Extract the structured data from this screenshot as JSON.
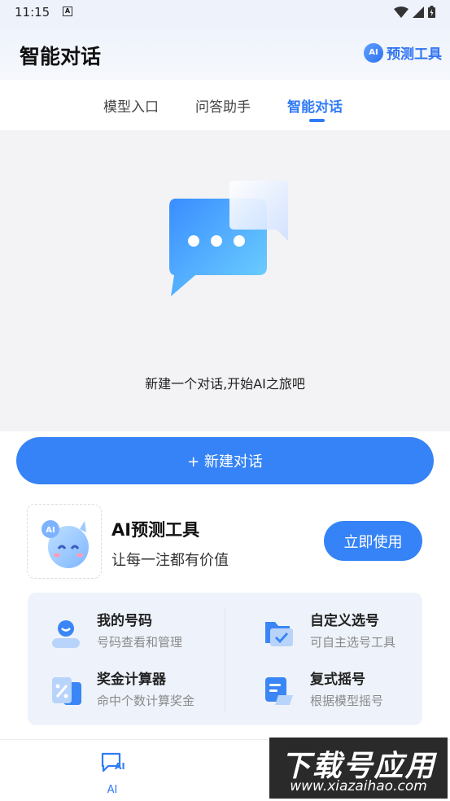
{
  "status_bar": {
    "time": "11:15",
    "notification_letter": "A"
  },
  "header": {
    "title": "智能对话",
    "predict_badge": "AI",
    "predict_label": "预测工具"
  },
  "tabs": [
    {
      "label": "模型入口"
    },
    {
      "label": "问答助手"
    },
    {
      "label": "智能对话"
    }
  ],
  "chat": {
    "empty_text": "新建一个对话,开始AI之旅吧"
  },
  "new_chat_button": "+ 新建对话",
  "promo": {
    "avatar_badge": "AI",
    "title": "AI预测工具",
    "subtitle": "让每一注都有价值",
    "button": "立即使用"
  },
  "tools": [
    {
      "title": "我的号码",
      "desc": "号码查看和管理",
      "icon": "user-icon"
    },
    {
      "title": "自定义选号",
      "desc": "可自主选号工具",
      "icon": "folder-check-icon"
    },
    {
      "title": "奖金计算器",
      "desc": "命中个数计算奖金",
      "icon": "calculator-icon"
    },
    {
      "title": "复式摇号",
      "desc": "根据模型摇号",
      "icon": "document-stack-icon"
    }
  ],
  "bottom_nav": {
    "ai_label": "AI",
    "ai_icon_text": "AI"
  },
  "watermark": {
    "title": "下载号应用",
    "url": "www.xiazaihao.com"
  },
  "colors": {
    "accent": "#3583f6",
    "tab_active": "#2f7bf6",
    "chat_bg": "#f3f3f5",
    "tools_bg": "#eef3fb"
  }
}
